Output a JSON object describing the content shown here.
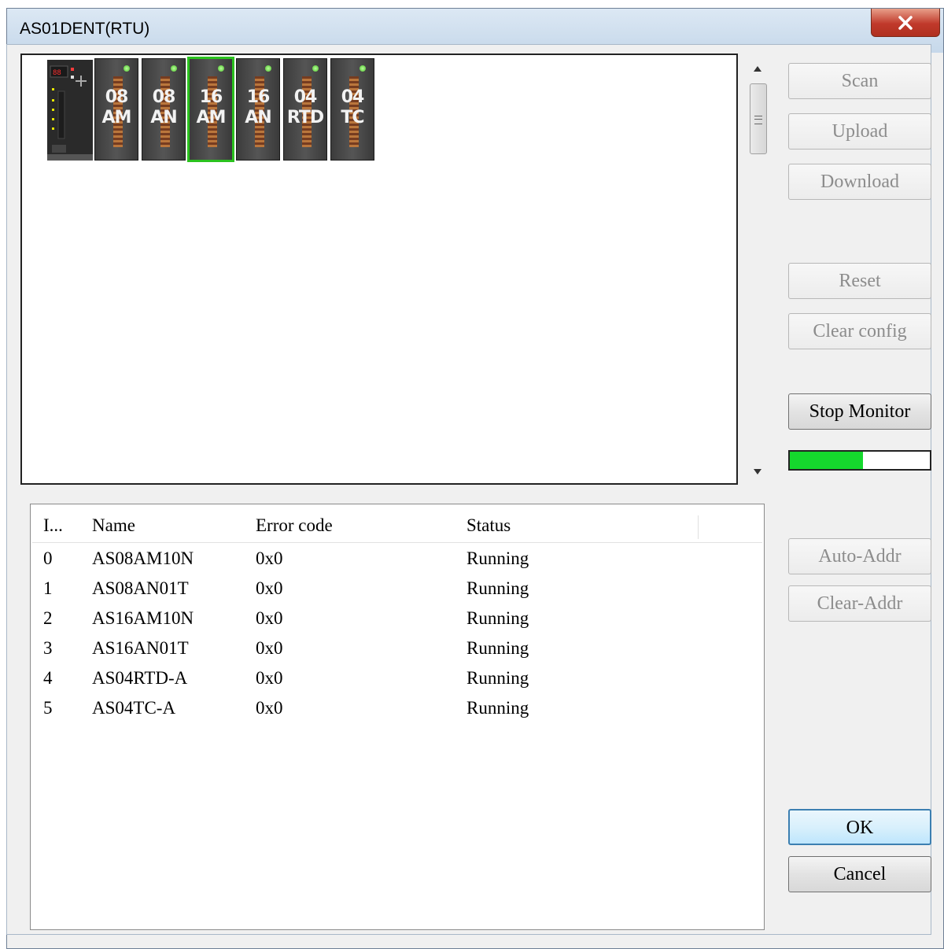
{
  "window": {
    "title": "AS01DENT(RTU)"
  },
  "rack": {
    "modules": [
      {
        "line1": "08",
        "line2": "AM"
      },
      {
        "line1": "08",
        "line2": "AN"
      },
      {
        "line1": "16",
        "line2": "AM"
      },
      {
        "line1": "16",
        "line2": "AN"
      },
      {
        "line1": "04",
        "line2": "RTD"
      },
      {
        "line1": "04",
        "line2": "TC"
      }
    ],
    "selected_index": 2
  },
  "buttons": {
    "scan": "Scan",
    "upload": "Upload",
    "download": "Download",
    "reset": "Reset",
    "clear_config": "Clear config",
    "stop_monitor": "Stop Monitor",
    "auto_addr": "Auto-Addr",
    "clear_addr": "Clear-Addr",
    "ok": "OK",
    "cancel": "Cancel"
  },
  "progress": {
    "fraction": 0.52,
    "color": "#15d82d"
  },
  "table": {
    "headers": [
      "I...",
      "Name",
      "Error code",
      "Status"
    ],
    "rows": [
      [
        "0",
        "AS08AM10N",
        "0x0",
        "Running"
      ],
      [
        "1",
        "AS08AN01T",
        "0x0",
        "Running"
      ],
      [
        "2",
        "AS16AM10N",
        "0x0",
        "Running"
      ],
      [
        "3",
        "AS16AN01T",
        "0x0",
        "Running"
      ],
      [
        "4",
        "AS04RTD-A",
        "0x0",
        "Running"
      ],
      [
        "5",
        "AS04TC-A",
        "0x0",
        "Running"
      ]
    ]
  },
  "colors": {
    "selection_outline": "#2bc21f",
    "close_button": "#c0392b"
  }
}
